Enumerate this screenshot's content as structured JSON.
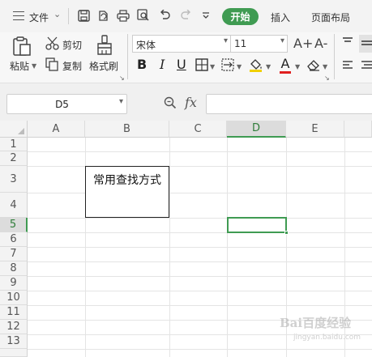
{
  "titlebar": {
    "file_label": "文件",
    "tabs": [
      "开始",
      "插入",
      "页面布局"
    ],
    "active_tab": "开始",
    "accent_color": "#3f9b52"
  },
  "ribbon": {
    "paste_label": "粘贴",
    "cut_label": "剪切",
    "copy_label": "复制",
    "format_painter_label": "格式刷",
    "font_name": "宋体",
    "font_size": "11",
    "grow_font": "A+",
    "shrink_font": "A-",
    "bold": "B",
    "italic": "I",
    "underline": "U",
    "font_color": "A"
  },
  "formula_bar": {
    "name_box": "D5",
    "fx_label": "fx",
    "formula": ""
  },
  "sheet": {
    "columns": [
      "A",
      "B",
      "C",
      "D",
      "E"
    ],
    "rows": [
      "1",
      "2",
      "3",
      "4",
      "5",
      "6",
      "7",
      "8",
      "9",
      "10",
      "11",
      "12",
      "13"
    ],
    "active_column": "D",
    "active_row": "5",
    "active_cell": "D5",
    "cells": {
      "B3": "常用查找方式",
      "B4": ""
    }
  },
  "watermark": {
    "text": "Bai百度经验",
    "sub": "jingyan.baidu.com"
  }
}
